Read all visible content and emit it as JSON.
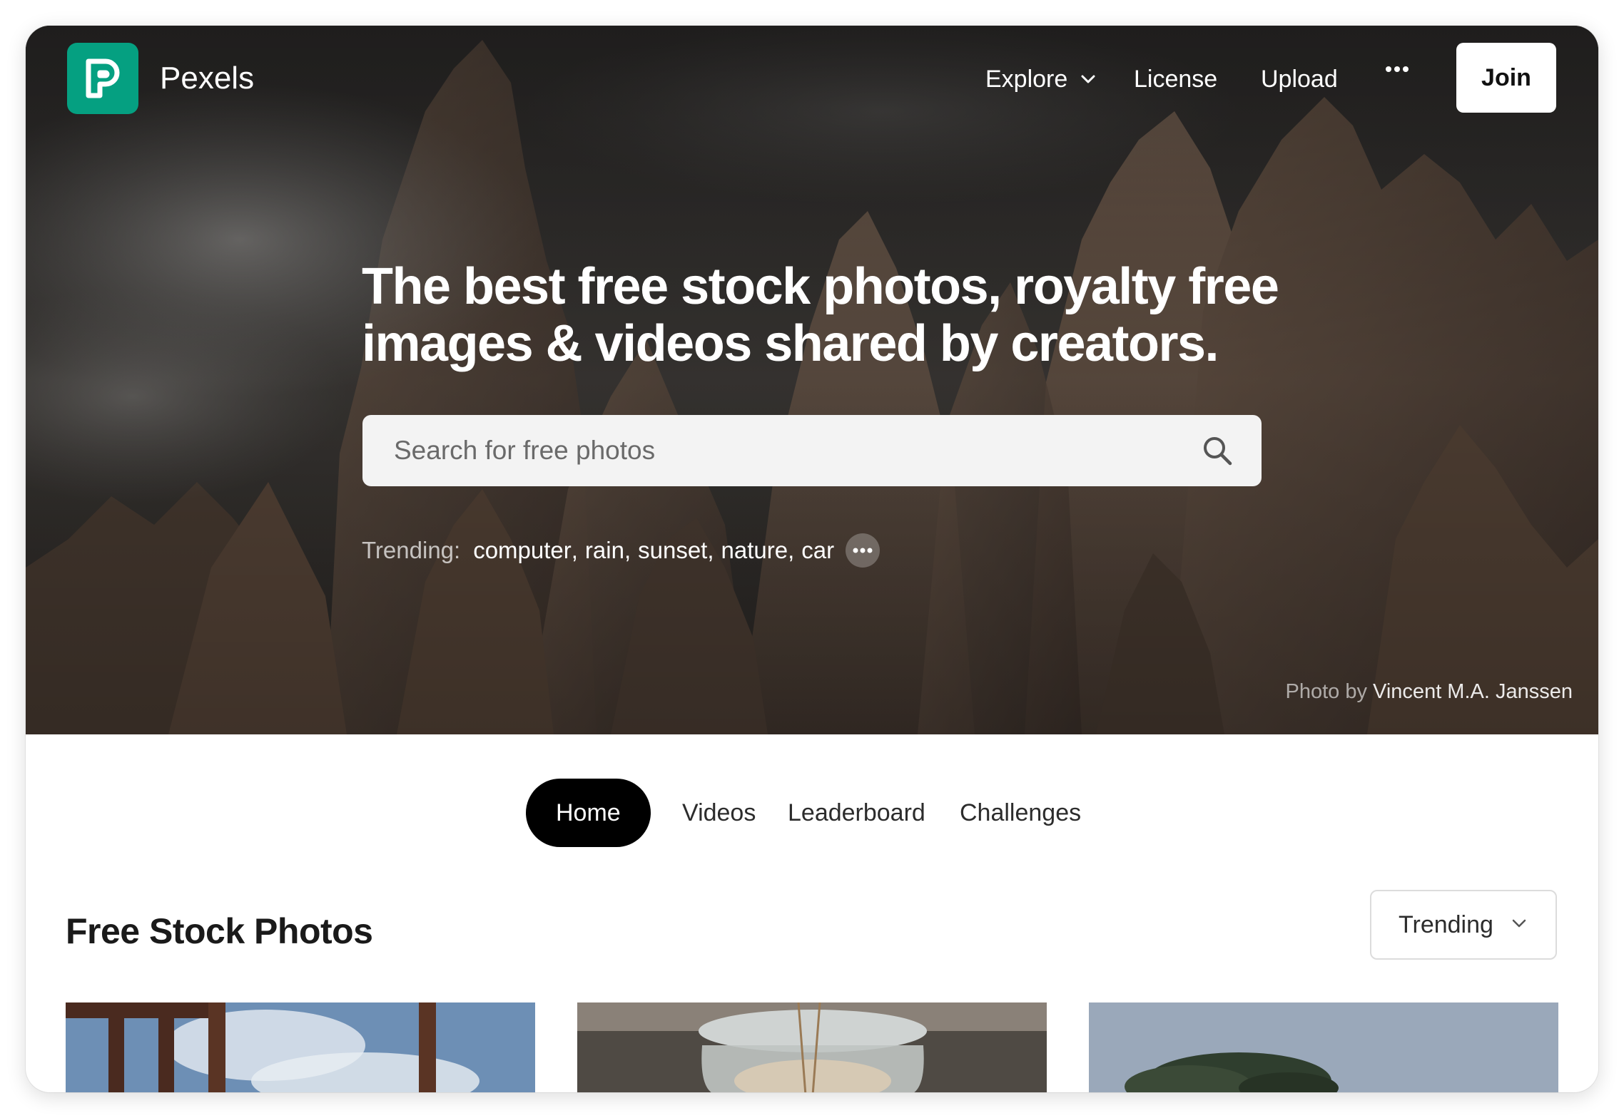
{
  "brand": {
    "name": "Pexels",
    "accent": "#05a081"
  },
  "nav": {
    "explore_label": "Explore",
    "license_label": "License",
    "upload_label": "Upload",
    "join_label": "Join"
  },
  "hero": {
    "headline": "The best free stock photos, royalty free\nimages & videos shared by creators.",
    "search_placeholder": "Search for free photos",
    "trending_label": "Trending:",
    "trending_terms": [
      "computer",
      "rain",
      "sunset",
      "nature",
      "car"
    ],
    "credit_prefix": "Photo by",
    "credit_author": "Vincent M.A. Janssen"
  },
  "tabs": [
    {
      "label": "Home",
      "active": true
    },
    {
      "label": "Videos",
      "active": false
    },
    {
      "label": "Leaderboard",
      "active": false
    },
    {
      "label": "Challenges",
      "active": false
    }
  ],
  "section": {
    "title": "Free Stock Photos",
    "sort_selected": "Trending"
  },
  "icons": [
    "chevron-down-icon",
    "more-dots-icon",
    "search-icon",
    "pexels-logo-icon"
  ]
}
